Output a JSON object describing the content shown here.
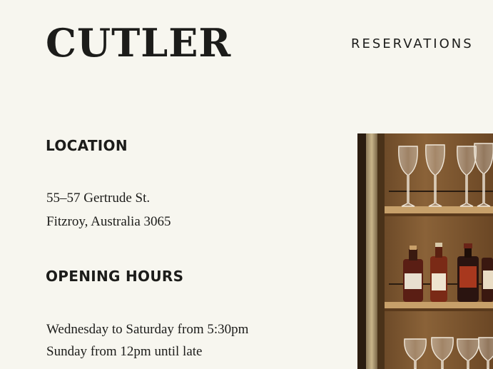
{
  "header": {
    "logo_text": "CUTLER",
    "nav": {
      "reservations_label": "RESERVATIONS"
    }
  },
  "location": {
    "heading": "LOCATION",
    "address_line1": "55–57 Gertrude St.",
    "address_line2": "Fitzroy, Australia 3065"
  },
  "hours": {
    "heading": "OPENING HOURS",
    "line1": "Wednesday to Saturday from 5:30pm",
    "line2": "Sunday from 12pm until late"
  },
  "photo": {
    "subject": "bar-shelves-glasses-bottles-photo"
  }
}
